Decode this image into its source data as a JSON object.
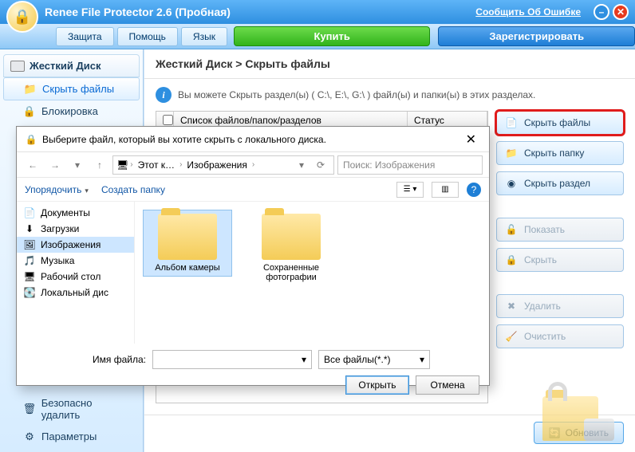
{
  "titlebar": {
    "title": "Renee File Protector 2.6 (Пробная)",
    "report_link": "Сообщить Об Ошибке"
  },
  "menubar": {
    "protect": "Защита",
    "help": "Помощь",
    "lang": "Язык",
    "buy": "Купить",
    "register": "Зарегистрировать"
  },
  "sidebar": {
    "hdd_header": "Жесткий Диск",
    "items": [
      {
        "label": "Скрыть файлы",
        "icon": "📁",
        "selected": true
      },
      {
        "label": "Блокировка",
        "icon": "🔒",
        "selected": false
      }
    ],
    "bottom": [
      {
        "label": "Безопасно удалить",
        "icon": "🗑"
      },
      {
        "label": "Параметры",
        "icon": "⚙"
      }
    ]
  },
  "content": {
    "breadcrumb_a": "Жесткий Диск",
    "breadcrumb_sep": " > ",
    "breadcrumb_b": "Скрыть файлы",
    "hint": "Вы можете Скрыть раздел(ы) ( C:\\, E:\\, G:\\ ) файл(ы) и папки(ы) в этих разделах.",
    "list_headers": {
      "name": "Список файлов/папок/разделов",
      "status": "Статус"
    },
    "actions": {
      "hide_files": "Скрыть файлы",
      "hide_folder": "Скрыть папку",
      "hide_part": "Скрыть раздел",
      "show": "Показать",
      "hide": "Скрыть",
      "delete": "Удалить",
      "clear": "Очистить"
    },
    "refresh": "Обновить"
  },
  "dialog": {
    "title": "Выберите файл, который вы хотите скрыть с локального диска.",
    "path": {
      "root": "Этот к…",
      "folder": "Изображения"
    },
    "search_placeholder": "Поиск: Изображения",
    "toolbar": {
      "organize": "Упорядочить",
      "new_folder": "Создать папку"
    },
    "tree": [
      {
        "label": "Документы",
        "icon": "📄"
      },
      {
        "label": "Загрузки",
        "icon": "⬇"
      },
      {
        "label": "Изображения",
        "icon": "🖼",
        "selected": true
      },
      {
        "label": "Музыка",
        "icon": "🎵"
      },
      {
        "label": "Рабочий стол",
        "icon": "🖥"
      },
      {
        "label": "Локальный дис",
        "icon": "💽"
      }
    ],
    "files": [
      {
        "label": "Альбом камеры",
        "selected": true
      },
      {
        "label": "Сохраненные фотографии",
        "selected": false
      }
    ],
    "filename_label": "Имя файла:",
    "filename_value": "",
    "filter": "Все файлы(*.*)",
    "open": "Открыть",
    "cancel": "Отмена"
  }
}
